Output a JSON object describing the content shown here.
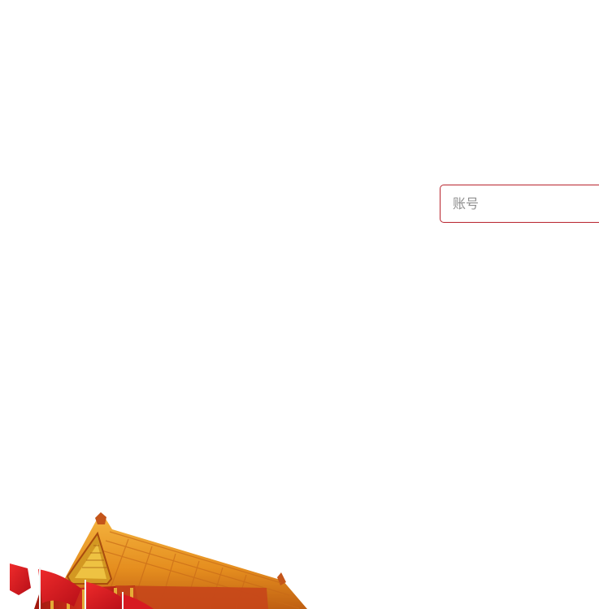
{
  "login": {
    "account_placeholder": "账号",
    "account_value": ""
  },
  "colors": {
    "accent": "#b8242e",
    "background": "#ffffff",
    "flag_red": "#d7141f",
    "roof_gold": "#e39a1b",
    "wall_red": "#b81f14"
  },
  "illustration": {
    "icon": "tiananmen-gate-with-red-flags-icon"
  }
}
